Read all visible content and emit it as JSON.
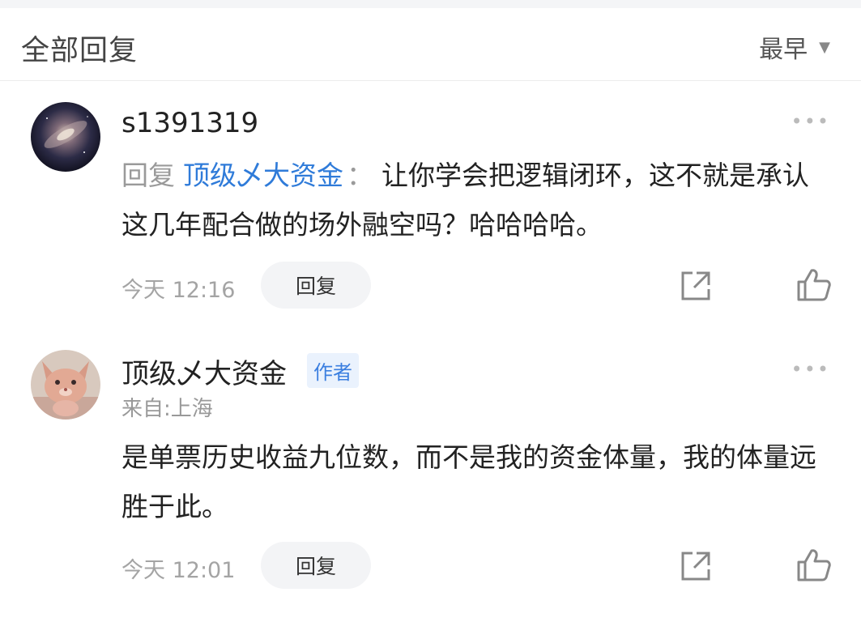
{
  "header": {
    "title": "全部回复",
    "sort_label": "最早",
    "sort_caret": "▼"
  },
  "comments": [
    {
      "username": "s1391319",
      "reply_prefix": "回复",
      "reply_target": "顶级乄大资金",
      "reply_colon": "：",
      "text": "让你学会把逻辑闭环，这不就是承认这几年配合做的场外融空吗？哈哈哈哈。",
      "time": "今天 12:16",
      "reply_button": "回复",
      "more": "•••",
      "avatar_icon": "galaxy-avatar"
    },
    {
      "username": "顶级乄大资金",
      "badge": "作者",
      "location": "来自:上海",
      "text": "是单票历史收益九位数，而不是我的资金体量，我的体量远胜于此。",
      "time": "今天 12:01",
      "reply_button": "回复",
      "more": "•••",
      "avatar_icon": "pink-cat-avatar"
    }
  ],
  "colors": {
    "link_blue": "#2f7bd9",
    "badge_blue": "#3b7fe0",
    "muted_gray": "#a4a4a4",
    "button_bg": "#f3f4f6"
  }
}
